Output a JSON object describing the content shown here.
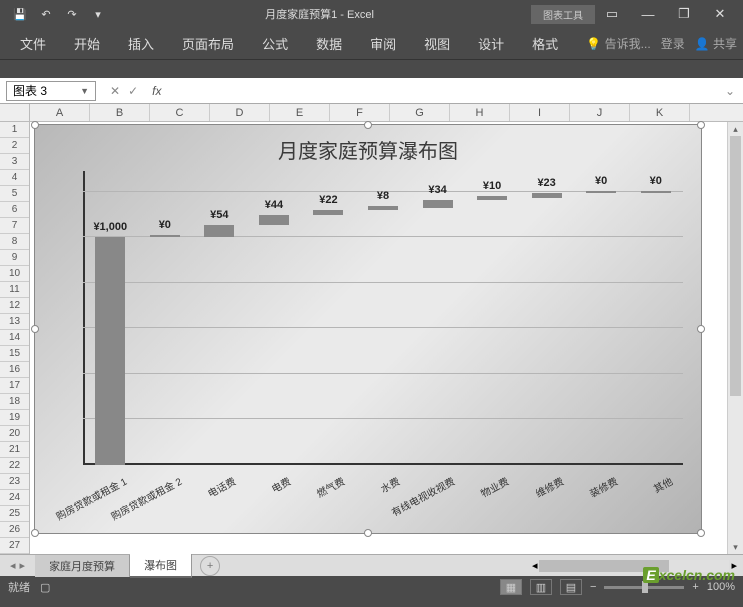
{
  "titlebar": {
    "doc_title": "月度家庭预算1 - Excel",
    "tools_label": "图表工具"
  },
  "ribbon": {
    "tabs": [
      "文件",
      "开始",
      "插入",
      "页面布局",
      "公式",
      "数据",
      "审阅",
      "视图",
      "设计",
      "格式"
    ],
    "tell_me": "告诉我...",
    "signin": "登录",
    "share": "共享"
  },
  "formula_bar": {
    "name_box": "图表 3",
    "fx": "fx"
  },
  "columns": [
    "A",
    "B",
    "C",
    "D",
    "E",
    "F",
    "G",
    "H",
    "I",
    "J",
    "K"
  ],
  "rows": [
    "1",
    "2",
    "3",
    "4",
    "5",
    "6",
    "7",
    "8",
    "9",
    "10",
    "11",
    "12",
    "13",
    "14",
    "15",
    "16",
    "17",
    "18",
    "19",
    "20",
    "21",
    "22",
    "23",
    "24",
    "25",
    "26",
    "27"
  ],
  "sheet_tabs": {
    "tab1": "家庭月度预算",
    "tab2": "瀑布图"
  },
  "statusbar": {
    "ready": "就绪",
    "zoom": "100%"
  },
  "watermark": {
    "e": "E",
    "txt": "xcelcn.com"
  },
  "chart_data": {
    "type": "bar",
    "title": "月度家庭预算瀑布图",
    "categories": [
      "购房贷款或租金 1",
      "购房贷款或租金 2",
      "电话费",
      "电费",
      "燃气费",
      "水费",
      "有线电视收视费",
      "物业费",
      "维修费",
      "装修费",
      "其他"
    ],
    "values": [
      1000,
      0,
      54,
      44,
      22,
      8,
      34,
      10,
      23,
      0,
      0
    ],
    "display_labels": [
      "¥1,000",
      "¥0",
      "¥54",
      "¥44",
      "¥22",
      "¥8",
      "¥34",
      "¥10",
      "¥23",
      "¥0",
      "¥0"
    ],
    "cumulative_base": [
      0,
      1000,
      1000,
      1054,
      1098,
      1120,
      1128,
      1162,
      1172,
      1195,
      1195
    ],
    "ylim": [
      0,
      1300
    ],
    "xlabel": "",
    "ylabel": ""
  }
}
